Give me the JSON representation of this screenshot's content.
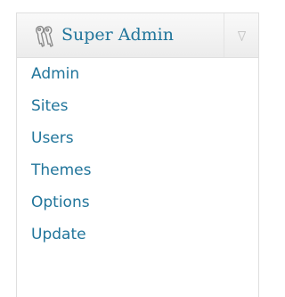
{
  "menu": {
    "header": {
      "title": "Super Admin",
      "icon": "admin-keys-icon",
      "toggle_icon": "dropdown-arrow-icon"
    },
    "items": [
      {
        "label": "Admin"
      },
      {
        "label": "Sites"
      },
      {
        "label": "Users"
      },
      {
        "label": "Themes"
      },
      {
        "label": "Options"
      },
      {
        "label": "Update"
      }
    ]
  },
  "colors": {
    "link": "#21759b",
    "border": "#dfdfdf",
    "header_bg_top": "#f9f9f9",
    "header_bg_bottom": "#ececec",
    "toggle_arrow": "#c8c8c8"
  }
}
